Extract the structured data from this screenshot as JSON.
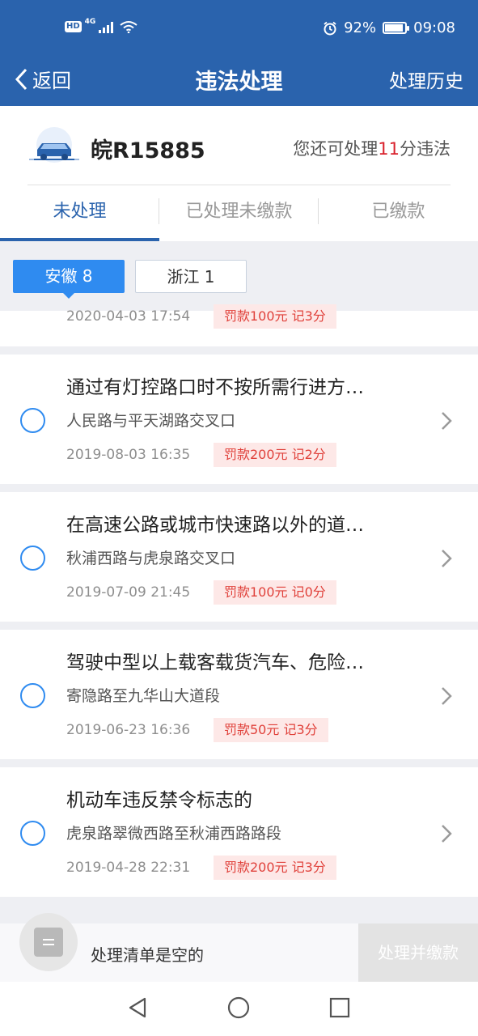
{
  "status_bar": {
    "hd": "HD",
    "network": "4G",
    "battery": "92%",
    "battery_level": 0.92,
    "time": "09:08"
  },
  "nav": {
    "back_label": "返回",
    "title": "违法处理",
    "history_label": "处理历史"
  },
  "car": {
    "plate": "皖R15885",
    "remaining_prefix": "您还可处理",
    "remaining_points": "11",
    "remaining_suffix": "分违法"
  },
  "tabs": [
    {
      "label": "未处理",
      "active": true
    },
    {
      "label": "已处理未缴款",
      "active": false
    },
    {
      "label": "已缴款",
      "active": false
    }
  ],
  "provinces": [
    {
      "label": "安徽 8",
      "selected": true
    },
    {
      "label": "浙江 1",
      "selected": false
    }
  ],
  "partial_item": {
    "time": "2020-04-03 17:54",
    "fine": "罚款100元 记3分"
  },
  "violations": [
    {
      "title": "通过有灯控路口时不按所需行进方…",
      "location": "人民路与平天湖路交叉口",
      "time": "2019-08-03 16:35",
      "fine": "罚款200元 记2分"
    },
    {
      "title": "在高速公路或城市快速路以外的道…",
      "location": "秋浦西路与虎泉路交叉口",
      "time": "2019-07-09 21:45",
      "fine": "罚款100元 记0分"
    },
    {
      "title": "驾驶中型以上载客载货汽车、危险…",
      "location": "寄隐路至九华山大道段",
      "time": "2019-06-23 16:36",
      "fine": "罚款50元 记3分"
    },
    {
      "title": "机动车违反禁令标志的",
      "location": "虎泉路翠微西路至秋浦西路路段",
      "time": "2019-04-28 22:31",
      "fine": "罚款200元 记3分"
    }
  ],
  "action_bar": {
    "empty_text": "处理清单是空的",
    "pay_label": "处理并缴款"
  },
  "colors": {
    "primary": "#2a63ad",
    "accent": "#2f8bf0",
    "warn": "#d9212c",
    "fine_bg": "#fde8e7"
  }
}
